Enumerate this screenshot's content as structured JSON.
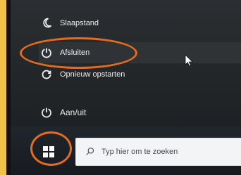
{
  "menu": {
    "sleep_label": "Slaapstand",
    "shutdown_label": "Afsluiten",
    "restart_label": "Opnieuw opstarten"
  },
  "power": {
    "label": "Aan/uit"
  },
  "taskbar": {
    "search_placeholder": "Typ hier om te zoeken"
  },
  "colors": {
    "highlight": "#e56b1f",
    "frame": "#f1c24a"
  },
  "icons": {
    "sleep": "moon-icon",
    "shutdown": "power-icon",
    "restart": "restart-icon",
    "power": "power-icon",
    "start": "windows-logo-icon",
    "search": "search-icon"
  }
}
